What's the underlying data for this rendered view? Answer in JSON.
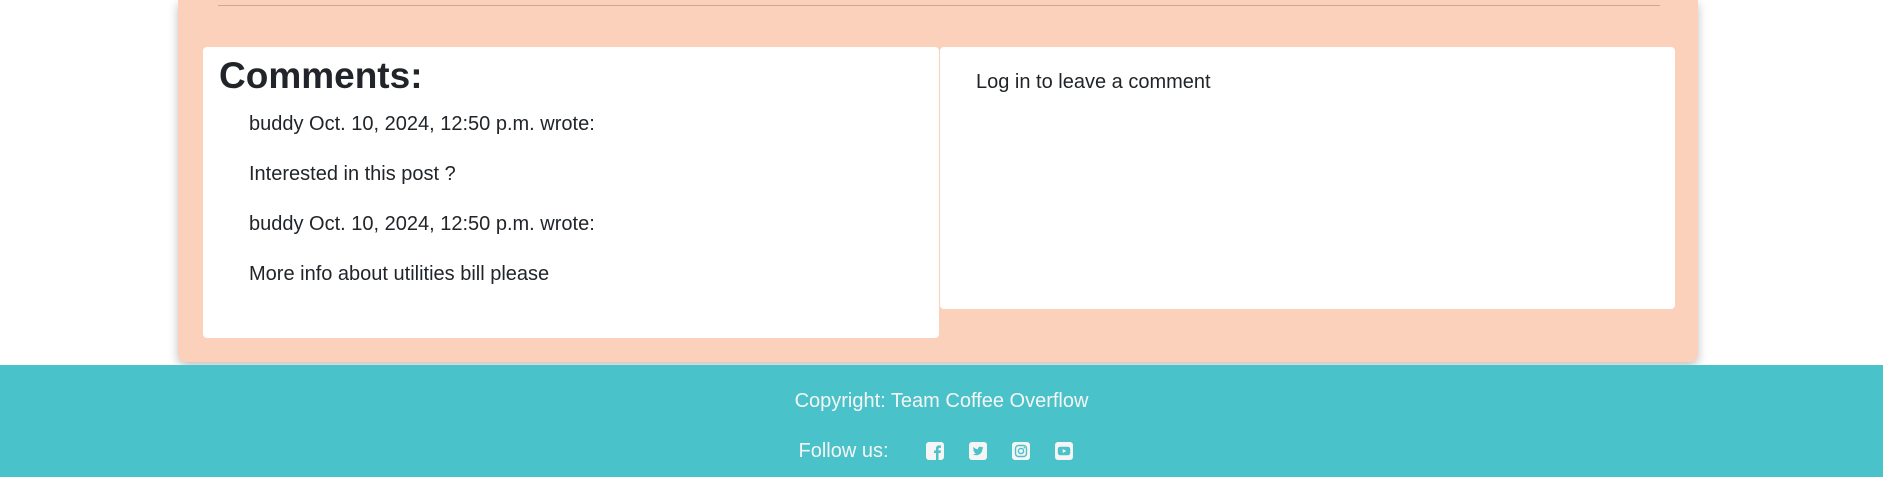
{
  "comments": {
    "heading": "Comments:",
    "items": [
      {
        "header": "buddy Oct. 10, 2024, 12:50 p.m. wrote:",
        "body": "Interested in this post ?"
      },
      {
        "header": "buddy Oct. 10, 2024, 12:50 p.m. wrote:",
        "body": "More info about utilities bill please"
      }
    ]
  },
  "comment_form": {
    "login_prompt": "Log in to leave a comment"
  },
  "footer": {
    "copyright": "Copyright: Team Coffee Overflow",
    "follow_label": "Follow us:",
    "social_icons": [
      "facebook-icon",
      "twitter-icon",
      "instagram-icon",
      "youtube-icon"
    ]
  },
  "colors": {
    "page_card": "#fcd1bc",
    "footer": "#4ac2c9",
    "text": "#212529"
  }
}
